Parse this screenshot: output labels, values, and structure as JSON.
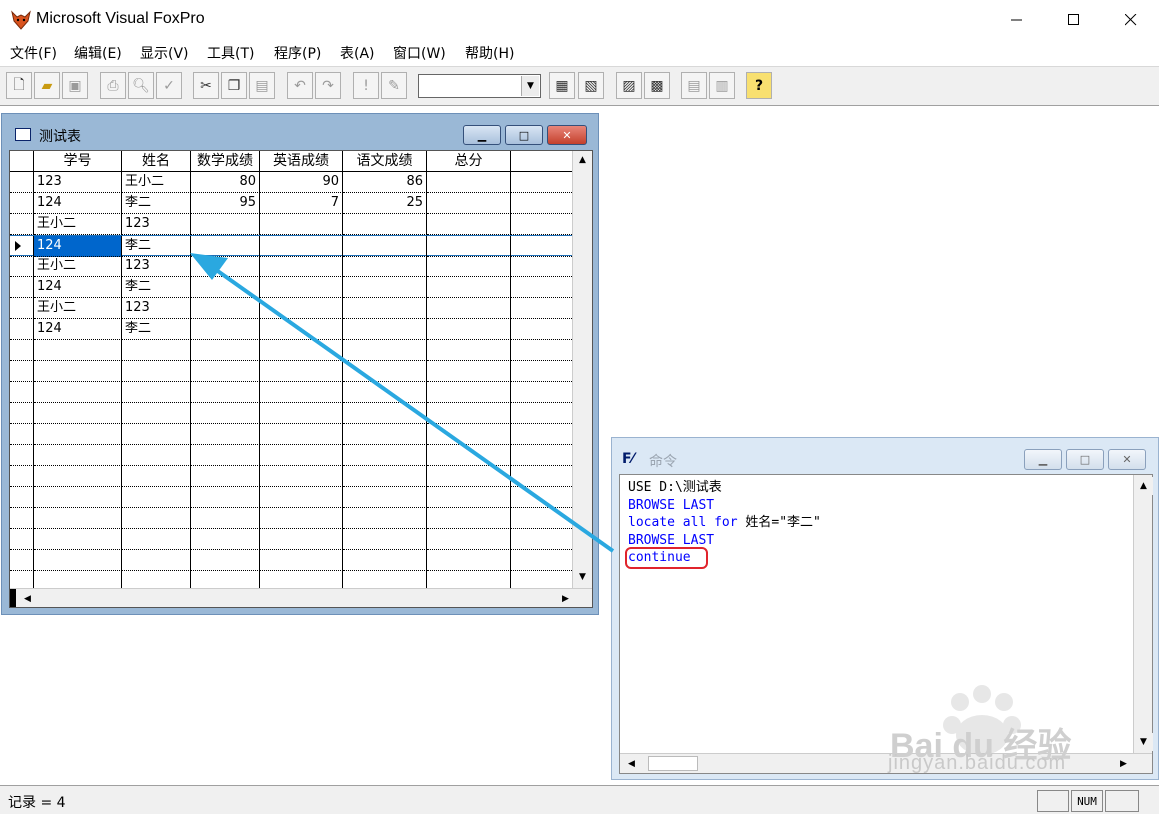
{
  "app": {
    "title": "Microsoft Visual FoxPro",
    "icon": "fox-icon",
    "window_controls": [
      "minimize",
      "maximize",
      "close"
    ]
  },
  "menu": [
    "文件(F)",
    "编辑(E)",
    "显示(V)",
    "工具(T)",
    "程序(P)",
    "表(A)",
    "窗口(W)",
    "帮助(H)"
  ],
  "toolbar": {
    "combo_value": "",
    "help_glyph": "?"
  },
  "browse_window": {
    "title": "测试表",
    "columns": [
      "学号",
      "姓名",
      "数学成绩",
      "英语成绩",
      "语文成绩",
      "总分"
    ],
    "rows": [
      [
        "123",
        "王小二",
        "80",
        "90",
        "86",
        ""
      ],
      [
        "124",
        "李二",
        "95",
        "7",
        "25",
        ""
      ],
      [
        "王小二",
        "123",
        "",
        "",
        "",
        ""
      ],
      [
        "124",
        "李二",
        "",
        "",
        "",
        ""
      ],
      [
        "王小二",
        "123",
        "",
        "",
        "",
        ""
      ],
      [
        "124",
        "李二",
        "",
        "",
        "",
        ""
      ],
      [
        "王小二",
        "123",
        "",
        "",
        "",
        ""
      ],
      [
        "124",
        "李二",
        "",
        "",
        "",
        ""
      ]
    ],
    "current_row": 4
  },
  "command_window": {
    "title": "命令",
    "lines": [
      {
        "pre": "USE D:\\测试表",
        "kw": "",
        "post": ""
      },
      {
        "pre": "",
        "kw": "BROWSE LAST",
        "post": ""
      },
      {
        "pre": "",
        "kw": "locate all for",
        "post": " 姓名=\"李二\""
      },
      {
        "pre": "",
        "kw": "BROWSE LAST",
        "post": ""
      },
      {
        "pre": "",
        "kw": "continue",
        "post": ""
      }
    ]
  },
  "status": {
    "text": "记录 = 4",
    "num": "NUM"
  },
  "watermark": {
    "brand": "Bai du 经验",
    "url": "jingyan.baidu.com"
  },
  "colors": {
    "keyword": "#0000ff",
    "highlight_box": "#e0242c",
    "arrow": "#2aa8e0",
    "selection": "#0066cc"
  }
}
